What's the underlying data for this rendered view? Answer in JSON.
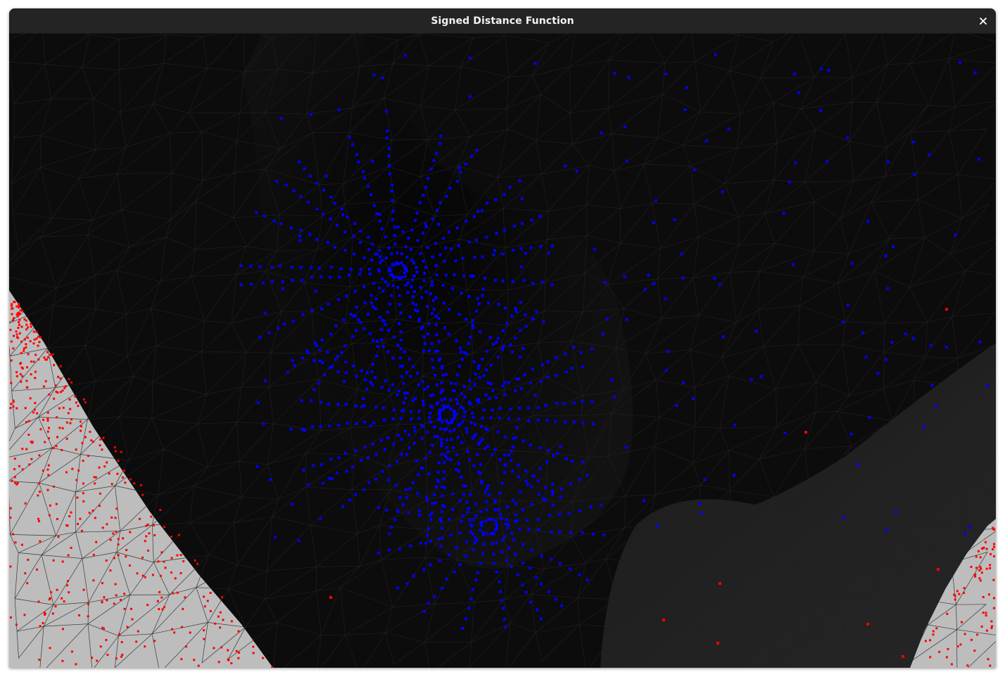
{
  "window": {
    "title": "Signed Distance Function"
  },
  "titlebar_buttons": {
    "close_icon": "close-icon"
  },
  "scene": {
    "background_color": "#bdbdbd",
    "mesh_color": "#0b0b0b",
    "mesh_edge_color": "#1e1e1e",
    "inside_point_color": "#0000ff",
    "outside_point_color": "#ff0000"
  }
}
